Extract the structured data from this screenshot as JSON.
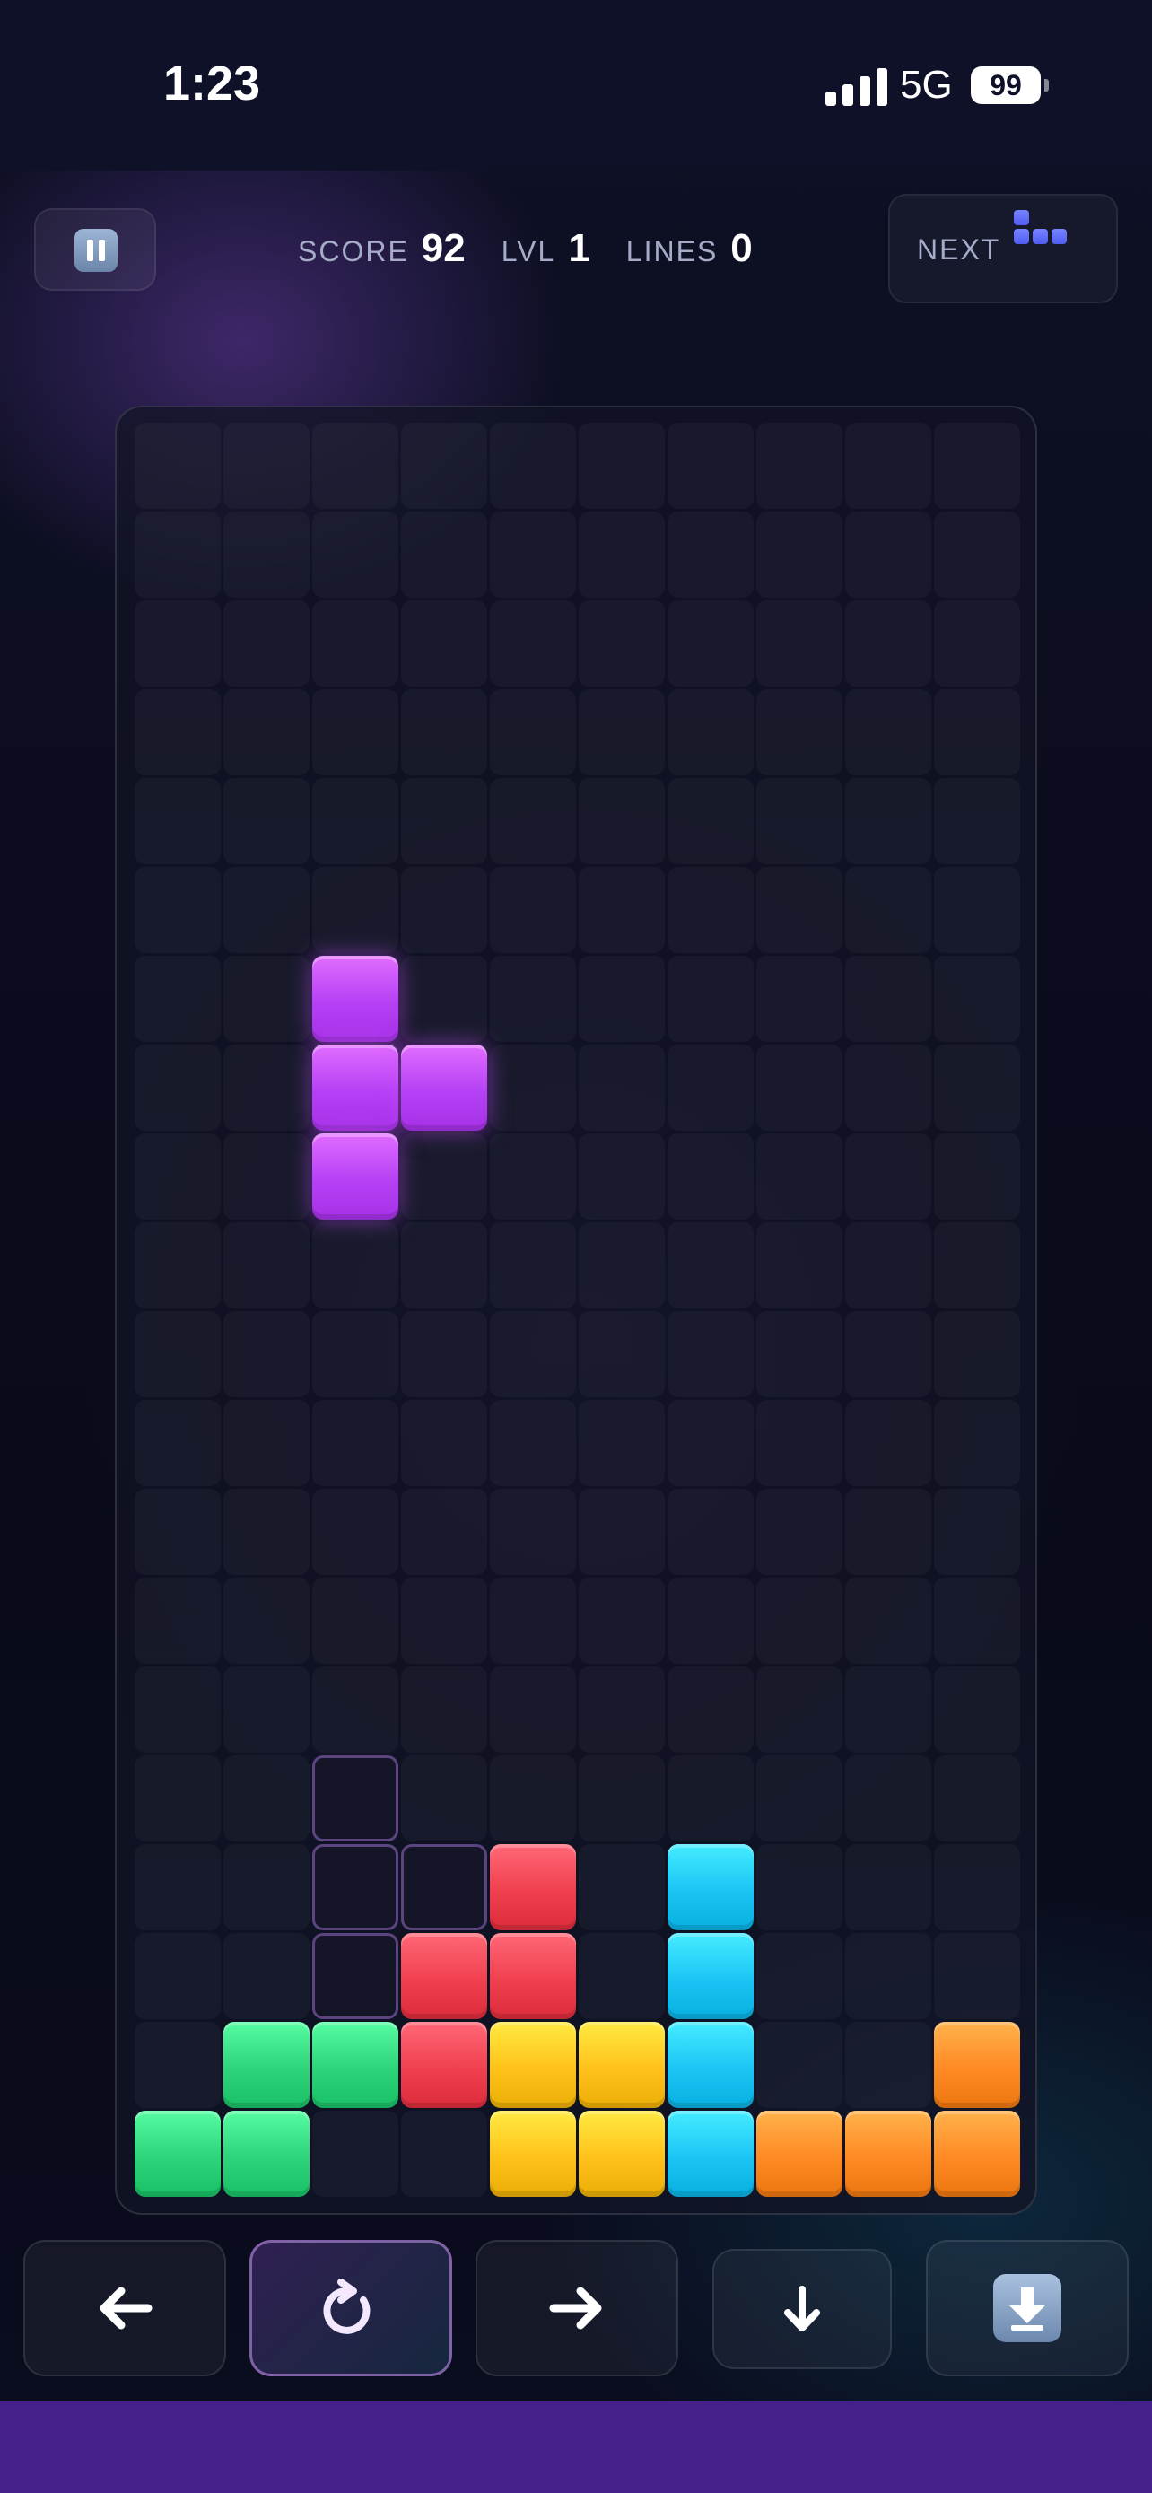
{
  "status_bar": {
    "time": "1:23",
    "network": "5G",
    "battery": "99"
  },
  "hud": {
    "score_label": "SCORE",
    "score": "92",
    "level_label": "LVL",
    "level": "1",
    "lines_label": "LINES",
    "lines": "0",
    "next_label": "NEXT",
    "next_piece": "J",
    "next_color": "#4f5cf0"
  },
  "board": {
    "columns": 10,
    "rows": 20,
    "colors": {
      "T": "#b540f5",
      "S": "#2ed47a",
      "Z": "#f0404f",
      "O": "#ffc21a",
      "I": "#1cc4f5",
      "L": "#ff8a24"
    },
    "active_piece": {
      "type": "T",
      "cells": [
        [
          2,
          6
        ],
        [
          2,
          7
        ],
        [
          3,
          7
        ],
        [
          2,
          8
        ]
      ]
    },
    "ghost_cells": [
      [
        2,
        15
      ],
      [
        2,
        16
      ],
      [
        3,
        16
      ],
      [
        2,
        17
      ]
    ],
    "locked_cells": [
      {
        "col": 4,
        "row": 16,
        "type": "Z"
      },
      {
        "col": 3,
        "row": 17,
        "type": "Z"
      },
      {
        "col": 4,
        "row": 17,
        "type": "Z"
      },
      {
        "col": 3,
        "row": 18,
        "type": "Z"
      },
      {
        "col": 6,
        "row": 16,
        "type": "I"
      },
      {
        "col": 6,
        "row": 17,
        "type": "I"
      },
      {
        "col": 6,
        "row": 18,
        "type": "I"
      },
      {
        "col": 6,
        "row": 19,
        "type": "I"
      },
      {
        "col": 1,
        "row": 18,
        "type": "S"
      },
      {
        "col": 2,
        "row": 18,
        "type": "S"
      },
      {
        "col": 0,
        "row": 19,
        "type": "S"
      },
      {
        "col": 1,
        "row": 19,
        "type": "S"
      },
      {
        "col": 4,
        "row": 18,
        "type": "O"
      },
      {
        "col": 5,
        "row": 18,
        "type": "O"
      },
      {
        "col": 4,
        "row": 19,
        "type": "O"
      },
      {
        "col": 5,
        "row": 19,
        "type": "O"
      },
      {
        "col": 9,
        "row": 18,
        "type": "L"
      },
      {
        "col": 7,
        "row": 19,
        "type": "L"
      },
      {
        "col": 8,
        "row": 19,
        "type": "L"
      },
      {
        "col": 9,
        "row": 19,
        "type": "L"
      }
    ]
  },
  "controls": [
    {
      "name": "move-left-button",
      "icon": "arrow-left-icon"
    },
    {
      "name": "rotate-button",
      "icon": "rotate-icon"
    },
    {
      "name": "move-right-button",
      "icon": "arrow-right-icon"
    },
    {
      "name": "soft-drop-button",
      "icon": "arrow-down-icon"
    },
    {
      "name": "hard-drop-button",
      "icon": "hard-drop-icon"
    }
  ]
}
